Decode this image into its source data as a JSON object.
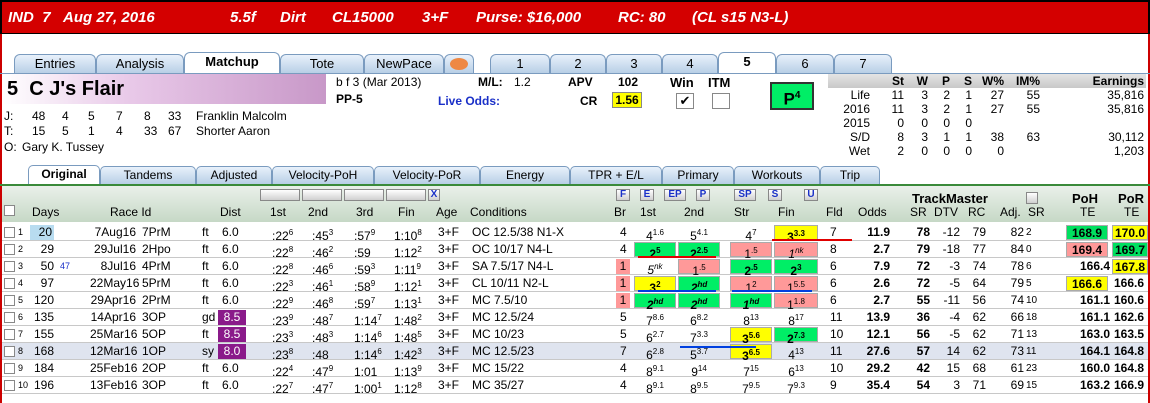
{
  "title": {
    "track": "IND",
    "race": "7",
    "date": "Aug 27, 2016",
    "dist": "5.5f",
    "surface": "Dirt",
    "class": "CL15000",
    "age": "3+F",
    "purse": "Purse: $16,000",
    "rc": "RC: 80",
    "cl": "(CL s15 N3-L)"
  },
  "tabs": [
    "Entries",
    "Analysis",
    "Matchup",
    "Tote",
    "NewPace",
    "1",
    "2",
    "3",
    "4",
    "5",
    "6",
    "7"
  ],
  "horse": {
    "name": "5  C J's Flair",
    "sex_age": "b f 3",
    "foal": "(Mar 2013)",
    "pp": "PP-5",
    "ml_label": "M/L:",
    "ml": "1.2",
    "apv_label": "APV",
    "apv": "102",
    "cr_label": "CR",
    "cr": "1.56",
    "live_odds": "Live Odds:",
    "win_label": "Win",
    "itm_label": "ITM",
    "win_check": "✔",
    "p_label": "P",
    "p_num": "4"
  },
  "jockey": {
    "label": "J:",
    "stats": [
      "48",
      "4",
      "5",
      "7",
      "8",
      "33"
    ],
    "name": "Franklin Malcolm"
  },
  "trainer": {
    "label": "T:",
    "stats": [
      "15",
      "5",
      "1",
      "4",
      "33",
      "67"
    ],
    "name": "Shorter Aaron"
  },
  "owner": {
    "label": "O:",
    "name": "Gary K. Tussey"
  },
  "record": {
    "headers": [
      "",
      "St",
      "W",
      "P",
      "S",
      "W%",
      "IM%",
      "Earnings"
    ],
    "rows": [
      [
        "Life",
        "11",
        "3",
        "2",
        "1",
        "27",
        "55",
        "35,816"
      ],
      [
        "2016",
        "11",
        "3",
        "2",
        "1",
        "27",
        "55",
        "35,816"
      ],
      [
        "2015",
        "0",
        "0",
        "0",
        "0",
        "",
        "",
        ""
      ],
      [
        "S/D",
        "8",
        "3",
        "1",
        "1",
        "38",
        "63",
        "30,112"
      ],
      [
        "Wet",
        "2",
        "0",
        "0",
        "0",
        "0",
        "",
        "1,203"
      ]
    ]
  },
  "subtabs": [
    "Original",
    "Tandems",
    "Adjusted",
    "Velocity-PoH",
    "Velocity-PoR",
    "Energy",
    "TPR + E/L",
    "Primary",
    "Workouts",
    "Trip"
  ],
  "buttons": {
    "x": "X",
    "F": "F",
    "E": "E",
    "EP": "EP",
    "P": "P",
    "SP": "SP",
    "S": "S",
    "U": "U"
  },
  "headers": {
    "days": "Days",
    "raceid": "Race Id",
    "dist": "Dist",
    "c1": "1st",
    "c2": "2nd",
    "c3": "3rd",
    "fin": "Fin",
    "age": "Age",
    "cond": "Conditions",
    "br": "Br",
    "p1": "1st",
    "p2": "2nd",
    "str": "Str",
    "pfin": "Fin",
    "fld": "Fld",
    "odds": "Odds",
    "trackmaster": "TrackMaster",
    "sr": "SR",
    "dtv": "DTV",
    "rc": "RC",
    "adj": "Adj.",
    "sr2": "SR",
    "poh": "PoH",
    "poh2": "TE",
    "por": "PoR",
    "por2": "TE"
  },
  "rows": [
    {
      "n": "1",
      "days": "20",
      "date": "7Aug16",
      "rid": "7PrM",
      "sf": "ft",
      "dist": "6.0",
      "c1": ":22",
      "c1s": "6",
      "c2": ":45",
      "c2s": "3",
      "c3": ":57",
      "c3s": "9",
      "fin": "1:10",
      "fins": "8",
      "age": "3+F",
      "cond": "OC 12.5/38 N1-X",
      "br": "4",
      "p1": "4",
      "p1s": "1.6",
      "p2": "5",
      "p2s": "4.1",
      "str": "4",
      "strs": "7",
      "pfin": "3",
      "pfins": "3.3",
      "fld": "7",
      "odds": "11.9",
      "sr": "78",
      "dtv": "-12",
      "rc": "79",
      "adj": "82",
      "adjs": "2",
      "poh": "168.9",
      "por": "170.0"
    },
    {
      "n": "2",
      "days": "29",
      "date": "29Jul16",
      "rid": "2Hpo",
      "sf": "ft",
      "dist": "6.0",
      "c1": ":22",
      "c1s": "8",
      "c2": ":46",
      "c2s": "2",
      "c3": ":59",
      "c3s": "",
      "fin": "1:12",
      "fins": "2",
      "age": "3+F",
      "cond": "OC 10/17 N4-L",
      "br": "4",
      "p1": "2",
      "p1s": "5",
      "p2": "2",
      "p2s": "2.5",
      "str": "1",
      "strs": ".5",
      "pfin": "1",
      "pfins": "nk",
      "fld": "8",
      "odds": "2.7",
      "sr": "79",
      "dtv": "-18",
      "rc": "77",
      "adj": "84",
      "adjs": "0",
      "poh": "169.4",
      "por": "169.7"
    },
    {
      "n": "3",
      "days": "50",
      "days2": "47",
      "date": "8Jul16",
      "rid": "4PrM",
      "sf": "ft",
      "dist": "6.0",
      "c1": ":22",
      "c1s": "8",
      "c2": ":46",
      "c2s": "6",
      "c3": ":59",
      "c3s": "3",
      "fin": "1:11",
      "fins": "9",
      "age": "3+F",
      "cond": "SA 7.5/17 N4-L",
      "br": "1",
      "p1": "5",
      "p1s": "nk",
      "p2": "1",
      "p2s": ".5",
      "str": "2",
      "strs": ".5",
      "pfin": "2",
      "pfins": "3",
      "fld": "6",
      "odds": "7.9",
      "sr": "72",
      "dtv": "-3",
      "rc": "74",
      "adj": "78",
      "adjs": "6",
      "poh": "166.4",
      "por": "167.8"
    },
    {
      "n": "4",
      "days": "97",
      "date": "22May16",
      "rid": "5PrM",
      "sf": "ft",
      "dist": "6.0",
      "c1": ":22",
      "c1s": "3",
      "c2": ":46",
      "c2s": "1",
      "c3": ":58",
      "c3s": "9",
      "fin": "1:12",
      "fins": "1",
      "age": "3+F",
      "cond": "CL 10/11 N2-L",
      "br": "1",
      "p1": "3",
      "p1s": "2",
      "p2": "2",
      "p2s": "hd",
      "str": "1",
      "strs": "2",
      "pfin": "1",
      "pfins": "5.5",
      "fld": "6",
      "odds": "2.6",
      "sr": "72",
      "dtv": "-5",
      "rc": "64",
      "adj": "79",
      "adjs": "5",
      "poh": "166.6",
      "por": "166.6"
    },
    {
      "n": "5",
      "days": "120",
      "date": "29Apr16",
      "rid": "2PrM",
      "sf": "ft",
      "dist": "6.0",
      "c1": ":22",
      "c1s": "9",
      "c2": ":46",
      "c2s": "8",
      "c3": ":59",
      "c3s": "7",
      "fin": "1:13",
      "fins": "1",
      "age": "3+F",
      "cond": "MC 7.5/10",
      "br": "1",
      "p1": "2",
      "p1s": "hd",
      "p2": "2",
      "p2s": "hd",
      "str": "1",
      "strs": "hd",
      "pfin": "1",
      "pfins": "1.8",
      "fld": "6",
      "odds": "2.7",
      "sr": "55",
      "dtv": "-11",
      "rc": "56",
      "adj": "74",
      "adjs": "10",
      "poh": "161.1",
      "por": "160.6"
    },
    {
      "n": "6",
      "days": "135",
      "date": "14Apr16",
      "rid": "3OP",
      "sf": "gd",
      "dist": "8.5",
      "c1": ":23",
      "c1s": "9",
      "c2": ":48",
      "c2s": "7",
      "c3": "1:14",
      "c3s": "7",
      "fin": "1:48",
      "fins": "2",
      "age": "3+F",
      "cond": "MC 12.5/24",
      "br": "5",
      "p1": "7",
      "p1s": "8.6",
      "p2": "6",
      "p2s": "8.2",
      "str": "8",
      "strs": "13",
      "pfin": "8",
      "pfins": "17",
      "fld": "11",
      "odds": "13.9",
      "sr": "36",
      "dtv": "-4",
      "rc": "62",
      "adj": "66",
      "adjs": "18",
      "poh": "161.1",
      "por": "162.6"
    },
    {
      "n": "7",
      "days": "155",
      "date": "25Mar16",
      "rid": "5OP",
      "sf": "ft",
      "dist": "8.5",
      "c1": ":23",
      "c1s": "3",
      "c2": ":48",
      "c2s": "3",
      "c3": "1:14",
      "c3s": "6",
      "fin": "1:48",
      "fins": "5",
      "age": "3+F",
      "cond": "MC 10/23",
      "br": "5",
      "p1": "6",
      "p1s": "2.7",
      "p2": "7",
      "p2s": "3.3",
      "str": "3",
      "strs": "5.6",
      "pfin": "2",
      "pfins": "7.3",
      "fld": "10",
      "odds": "12.1",
      "sr": "56",
      "dtv": "-5",
      "rc": "62",
      "adj": "71",
      "adjs": "13",
      "poh": "163.0",
      "por": "163.5"
    },
    {
      "n": "8",
      "days": "168",
      "date": "12Mar16",
      "rid": "1OP",
      "sf": "sy",
      "dist": "8.0",
      "c1": ":23",
      "c1s": "8",
      "c2": ":48",
      "c2s": "",
      "c3": "1:14",
      "c3s": "6",
      "fin": "1:42",
      "fins": "3",
      "age": "3+F",
      "cond": "MC 12.5/23",
      "br": "7",
      "p1": "6",
      "p1s": "2.8",
      "p2": "5",
      "p2s": "3.7",
      "str": "3",
      "strs": "6.5",
      "pfin": "4",
      "pfins": "13",
      "fld": "11",
      "odds": "27.6",
      "sr": "57",
      "dtv": "14",
      "rc": "62",
      "adj": "73",
      "adjs": "11",
      "poh": "164.1",
      "por": "164.8"
    },
    {
      "n": "9",
      "days": "184",
      "date": "25Feb16",
      "rid": "2OP",
      "sf": "ft",
      "dist": "6.0",
      "c1": ":22",
      "c1s": "4",
      "c2": ":47",
      "c2s": "9",
      "c3": "1:01",
      "c3s": "",
      "fin": "1:13",
      "fins": "9",
      "age": "3+F",
      "cond": "MC 15/22",
      "br": "4",
      "p1": "8",
      "p1s": "9.1",
      "p2": "9",
      "p2s": "14",
      "str": "7",
      "strs": "15",
      "pfin": "6",
      "pfins": "13",
      "fld": "10",
      "odds": "29.2",
      "sr": "42",
      "dtv": "15",
      "rc": "68",
      "adj": "61",
      "adjs": "23",
      "poh": "160.0",
      "por": "164.8"
    },
    {
      "n": "10",
      "days": "196",
      "date": "13Feb16",
      "rid": "3OP",
      "sf": "ft",
      "dist": "6.0",
      "c1": ":22",
      "c1s": "7",
      "c2": ":47",
      "c2s": "7",
      "c3": "1:00",
      "c3s": "1",
      "fin": "1:12",
      "fins": "8",
      "age": "3+F",
      "cond": "MC 35/27",
      "br": "4",
      "p1": "8",
      "p1s": "9.1",
      "p2": "8",
      "p2s": "9.5",
      "str": "7",
      "strs": "9.5",
      "pfin": "7",
      "pfins": "9.3",
      "fld": "9",
      "odds": "35.4",
      "sr": "54",
      "dtv": "3",
      "rc": "71",
      "adj": "69",
      "adjs": "15",
      "poh": "163.2",
      "por": "166.9"
    }
  ]
}
